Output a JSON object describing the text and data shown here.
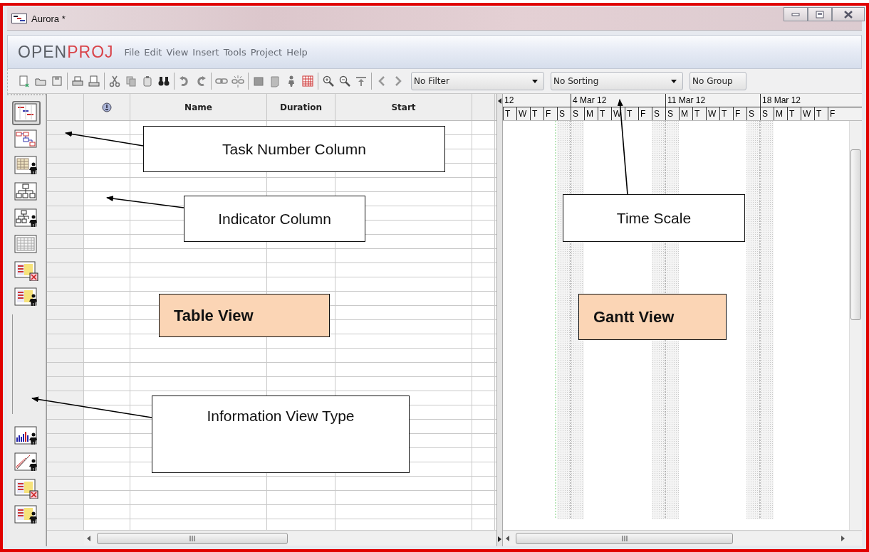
{
  "window": {
    "title": "Aurora *"
  },
  "logo": {
    "parts": [
      "OPEN",
      "PROJ"
    ]
  },
  "menu": [
    "File",
    "Edit",
    "View",
    "Insert",
    "Tools",
    "Project",
    "Help"
  ],
  "dropdowns": [
    {
      "value": "No Filter"
    },
    {
      "value": "No Sorting"
    },
    {
      "value": "No Group"
    }
  ],
  "view_bar": {
    "top": [
      {
        "kind": "gantt",
        "selected": true
      },
      {
        "kind": "network",
        "selected": false
      },
      {
        "kind": "resources",
        "selected": false
      },
      {
        "kind": "wbs",
        "selected": false
      },
      {
        "kind": "rbs",
        "selected": false
      },
      {
        "kind": "grid",
        "selected": false
      },
      {
        "kind": "task_usage",
        "selected": false
      },
      {
        "kind": "resource_usage",
        "selected": false
      }
    ],
    "bottom": [
      {
        "kind": "histogram",
        "selected": false
      },
      {
        "kind": "charts",
        "selected": false
      },
      {
        "kind": "task_usage",
        "selected": false
      },
      {
        "kind": "resource_usage",
        "selected": false
      }
    ]
  },
  "table": {
    "columns": [
      {
        "kind": "row_number"
      },
      {
        "kind": "indicator"
      },
      {
        "kind": "text",
        "label": "Name"
      },
      {
        "kind": "text",
        "label": "Duration"
      },
      {
        "kind": "text",
        "label": "Start"
      },
      {
        "kind": "blank"
      }
    ]
  },
  "timescale": {
    "weeks": [
      "12",
      "4 Mar 12",
      "11 Mar 12",
      "18 Mar 12"
    ],
    "days": [
      "T",
      "W",
      "T",
      "F",
      "S",
      "S",
      "M",
      "T",
      "W",
      "T",
      "F",
      "S",
      "S",
      "M",
      "T",
      "W",
      "T",
      "F",
      "S",
      "S",
      "M",
      "T",
      "W",
      "T",
      "F"
    ]
  },
  "annotations": [
    {
      "kind": "label",
      "text": "Task Number Column"
    },
    {
      "kind": "label",
      "text": "Indicator Column"
    },
    {
      "kind": "label",
      "text": "Time Scale"
    },
    {
      "kind": "highlight",
      "text": "Table View"
    },
    {
      "kind": "highlight",
      "text": "Gantt View"
    },
    {
      "kind": "label",
      "text": "Information View Type"
    }
  ]
}
